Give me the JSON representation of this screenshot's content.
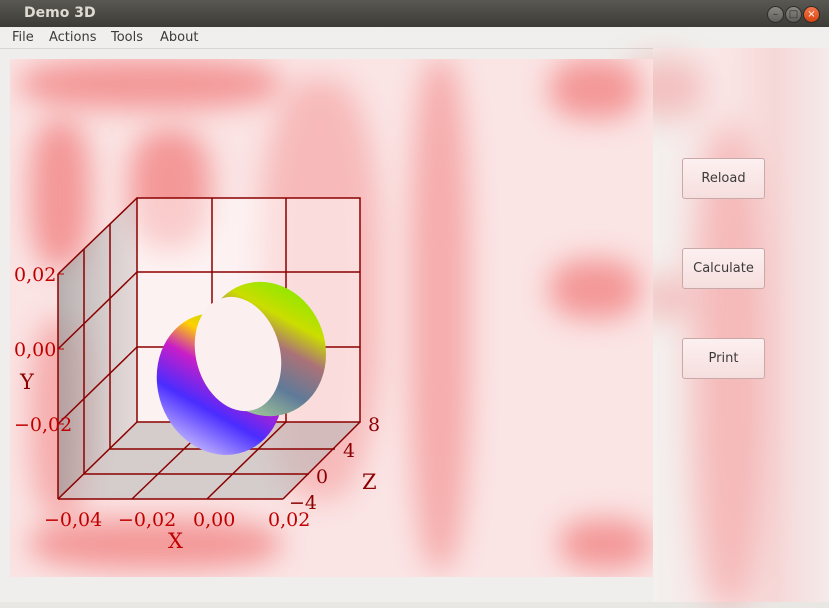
{
  "window": {
    "title": "Demo 3D"
  },
  "menu": {
    "items": [
      "File",
      "Actions",
      "Tools",
      "About"
    ]
  },
  "buttons": {
    "reload": "Reload",
    "calculate": "Calculate",
    "print": "Print"
  },
  "chart_data": {
    "type": "surface3d",
    "axes": {
      "x": {
        "label": "X",
        "ticks": [
          "−0,04",
          "−0,02",
          "0,00",
          "0,02"
        ]
      },
      "y": {
        "label": "Y",
        "ticks": [
          "0,02",
          "0,00",
          "−0,02"
        ]
      },
      "z": {
        "label": "Z",
        "ticks": [
          "8",
          "4",
          "0",
          "−4"
        ]
      }
    },
    "grid": true
  },
  "colors": {
    "accent": "#e85050",
    "axis": "#8b0000",
    "tick_text": "#c00000"
  }
}
